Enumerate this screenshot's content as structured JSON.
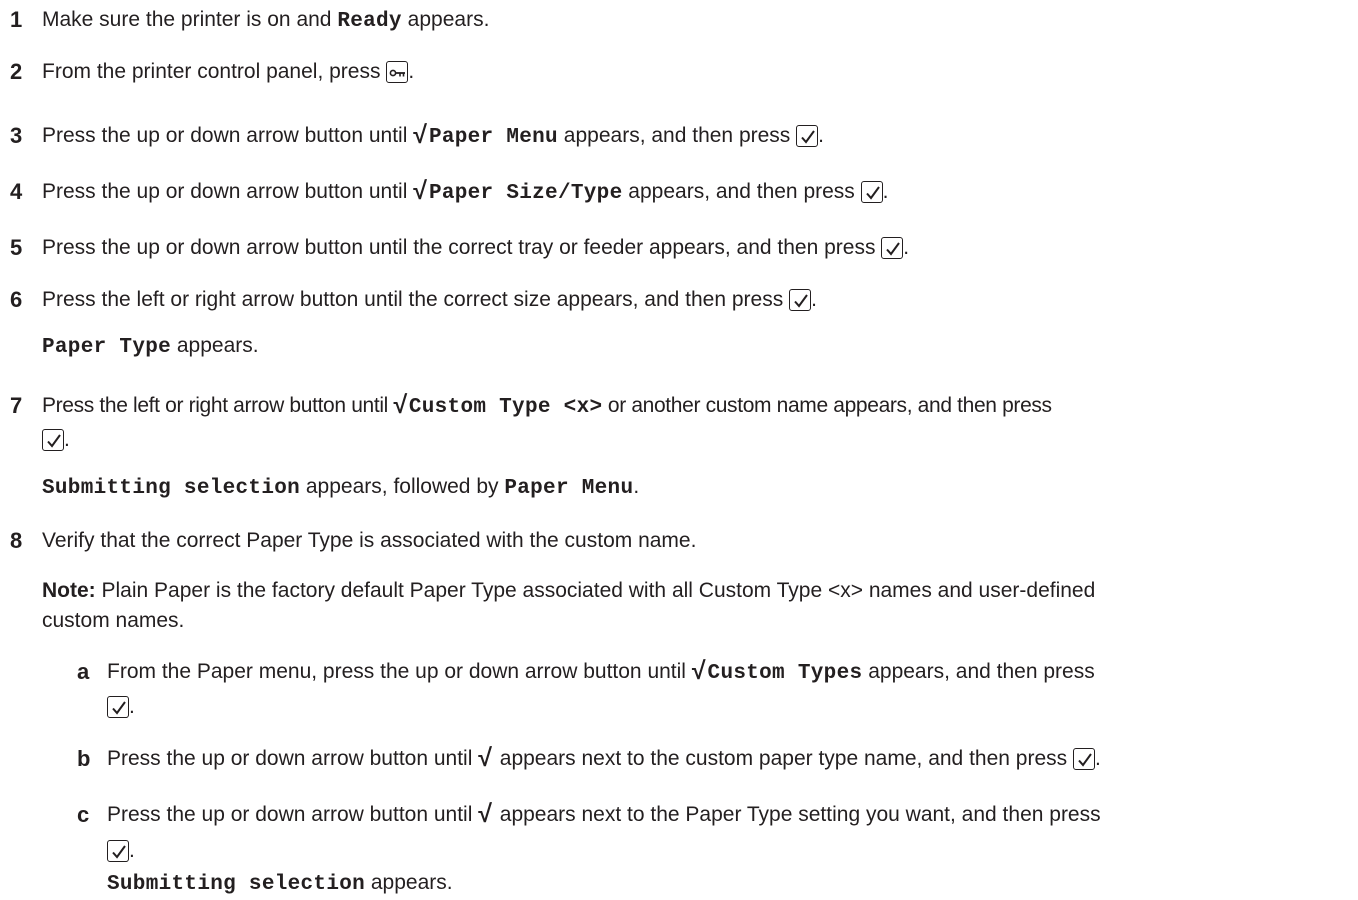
{
  "steps": [
    {
      "num": "1",
      "before": "Make sure the printer is on and ",
      "code": "Ready",
      "after": " appears."
    },
    {
      "num": "2",
      "before": "From the printer control panel, press ",
      "after": "."
    },
    {
      "num": "3",
      "before": "Press the up or down arrow button until ",
      "code": "Paper Menu",
      "after": " appears, and then press ",
      "end": "."
    },
    {
      "num": "4",
      "before": "Press the up or down arrow button until ",
      "code": "Paper Size/Type",
      "after": " appears, and then press ",
      "end": "."
    },
    {
      "num": "5",
      "before": "Press the up or down arrow button until the correct tray or feeder appears, and then press ",
      "end": "."
    },
    {
      "num": "6",
      "before": "Press the left or right arrow button until the correct size appears, and then press ",
      "end": "."
    },
    {
      "code_line_6": "Paper Type",
      "after_line_6": " appears."
    },
    {
      "num": "7",
      "before": "Press the left or right arrow button until ",
      "code": "Custom Type <x>",
      "after": " or another custom name appears, and then press",
      "end": "."
    },
    {
      "code_a": "Submitting selection",
      "mid": " appears, followed by ",
      "code_b": "Paper Menu",
      "end": "."
    },
    {
      "num": "8",
      "text": "Verify that the correct Paper Type is associated with the custom name."
    }
  ],
  "note": {
    "label": "Note:",
    "text1": " Plain Paper is the factory default Paper Type associated with all Custom Type <x> names and user-defined",
    "text2": "custom names."
  },
  "substeps": [
    {
      "letter": "a",
      "before": "From the Paper menu, press the up or down arrow button until ",
      "code": "Custom Types",
      "after": " appears, and then press",
      "end": "."
    },
    {
      "letter": "b",
      "before": "Press the up or down arrow button until ",
      "after": " appears next to the custom paper type name, and then press ",
      "end": "."
    },
    {
      "letter": "c",
      "before": "Press the up or down arrow button until ",
      "after": " appears next to the Paper Type setting you want, and then press",
      "end": "."
    }
  ],
  "final": {
    "code": "Submitting selection",
    "after": " appears."
  },
  "icons": {
    "check_symbol": "√",
    "select_button": "checkmark-button-icon",
    "menu_button": "key-menu-button-icon"
  }
}
